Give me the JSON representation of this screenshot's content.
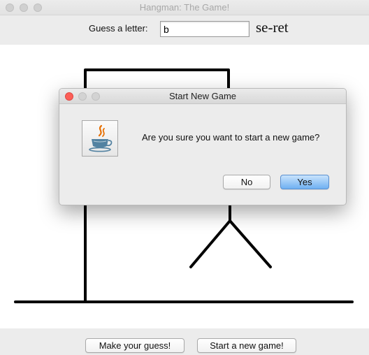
{
  "window": {
    "title": "Hangman: The Game!"
  },
  "guess": {
    "label": "Guess a letter:",
    "value": "b",
    "word": "se-ret"
  },
  "buttons": {
    "make_guess": "Make your guess!",
    "new_game": "Start a new game!"
  },
  "dialog": {
    "title": "Start New Game",
    "message": "Are you sure you want to start a new game?",
    "no_label": "No",
    "yes_label": "Yes",
    "icon": "java-icon"
  },
  "colors": {
    "window_bg": "#ececec",
    "canvas_bg": "#ffffff",
    "close_red": "#fc5f57",
    "default_button_blue": "#6fb0f2",
    "drawing": "#000000"
  }
}
